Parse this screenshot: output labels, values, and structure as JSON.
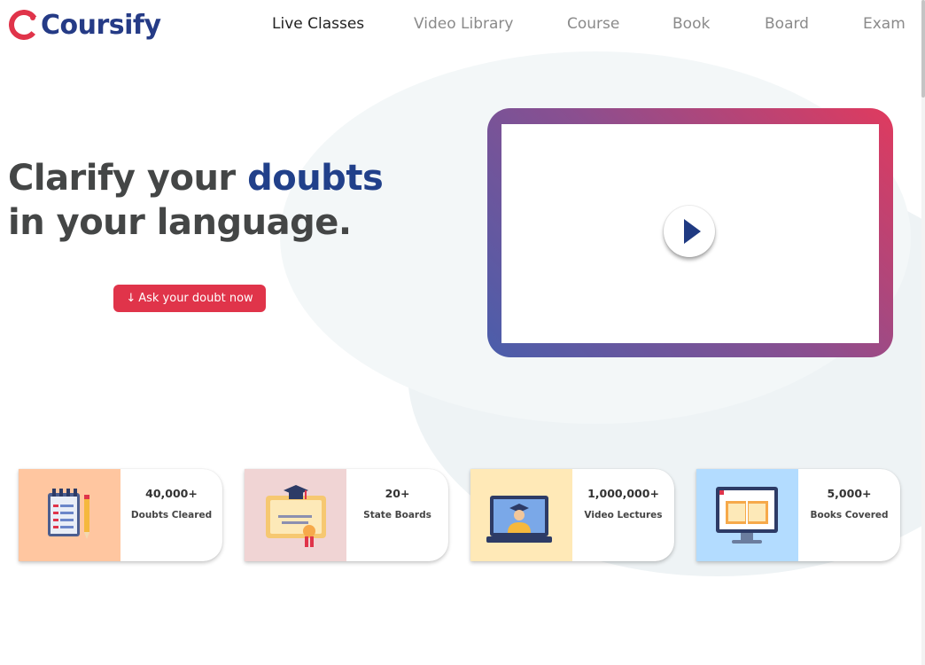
{
  "brand": {
    "name": "Coursify",
    "mark_letter": "C",
    "colors": {
      "red": "#e0344a",
      "navy": "#253b86"
    }
  },
  "nav": {
    "items": [
      {
        "label": "Live Classes",
        "active": true
      },
      {
        "label": "Video Library",
        "active": false
      },
      {
        "label": "Course",
        "active": false
      },
      {
        "label": "Book",
        "active": false
      },
      {
        "label": "Board",
        "active": false
      },
      {
        "label": "Exam",
        "active": false
      }
    ]
  },
  "hero": {
    "title_part1": "Clarify your ",
    "title_accent": "doubts",
    "title_line2": "in your language.",
    "cta_icon": "↓",
    "cta_label": "Ask your doubt now"
  },
  "video": {
    "play_icon": "play-icon"
  },
  "stats": [
    {
      "value": "40,000+",
      "label": "Doubts Cleared",
      "icon": "notepad-pencil-icon",
      "bg": "#ffc6a0"
    },
    {
      "value": "20+",
      "label": "State Boards",
      "icon": "certificate-icon",
      "bg": "#f0d4d4"
    },
    {
      "value": "1,000,000+",
      "label": "Video Lectures",
      "icon": "graduate-laptop-icon",
      "bg": "#ffe9b7"
    },
    {
      "value": "5,000+",
      "label": "Books Covered",
      "icon": "monitor-book-icon",
      "bg": "#b3dcff"
    }
  ],
  "colors": {
    "accent_text": "#21408a",
    "heading": "#444646",
    "cta_bg": "#e0344a"
  }
}
